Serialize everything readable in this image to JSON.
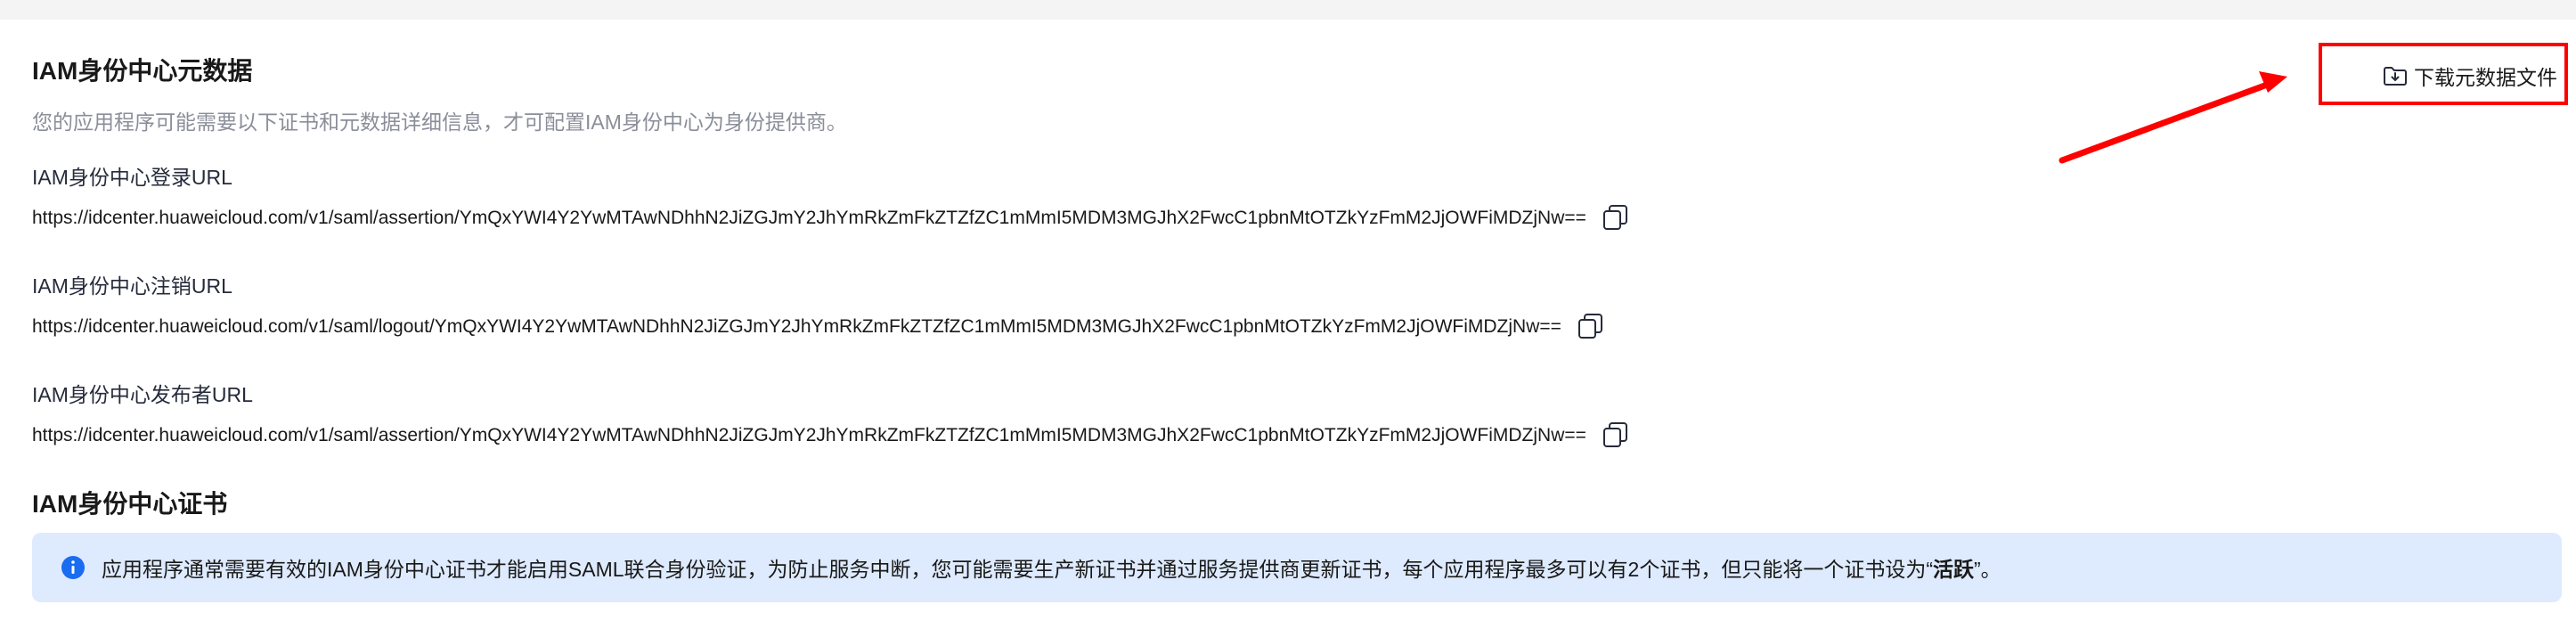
{
  "section1": {
    "title": "IAM身份中心元数据",
    "description": "您的应用程序可能需要以下证书和元数据详细信息，才可配置IAM身份中心为身份提供商。",
    "download_label": "下载元数据文件",
    "fields": [
      {
        "label": "IAM身份中心登录URL",
        "value": "https://idcenter.huaweicloud.com/v1/saml/assertion/YmQxYWI4Y2YwMTAwNDhhN2JiZGJmY2JhYmRkZmFkZTZfZC1mMmI5MDM3MGJhX2FwcC1pbnMtOTZkYzFmM2JjOWFiMDZjNw=="
      },
      {
        "label": "IAM身份中心注销URL",
        "value": "https://idcenter.huaweicloud.com/v1/saml/logout/YmQxYWI4Y2YwMTAwNDhhN2JiZGJmY2JhYmRkZmFkZTZfZC1mMmI5MDM3MGJhX2FwcC1pbnMtOTZkYzFmM2JjOWFiMDZjNw=="
      },
      {
        "label": "IAM身份中心发布者URL",
        "value": "https://idcenter.huaweicloud.com/v1/saml/assertion/YmQxYWI4Y2YwMTAwNDhhN2JiZGJmY2JhYmRkZmFkZTZfZC1mMmI5MDM3MGJhX2FwcC1pbnMtOTZkYzFmM2JjOWFiMDZjNw=="
      }
    ]
  },
  "section2": {
    "title": "IAM身份中心证书",
    "info_text": "应用程序通常需要有效的IAM身份中心证书才能启用SAML联合身份验证，为防止服务中断，您可能需要生产新证书并通过服务提供商更新证书，每个应用程序最多可以有2个证书，但只能将一个证书设为“",
    "info_strong": "活跃",
    "info_suffix": "”。"
  },
  "icons": {
    "copy": "copy-icon",
    "info": "info-icon",
    "folder_download": "folder-download-icon"
  },
  "colors": {
    "info_background": "#deeafd",
    "info_icon": "#1a6cf0",
    "annotation": "#ff0000",
    "muted_text": "#8a8e99"
  }
}
